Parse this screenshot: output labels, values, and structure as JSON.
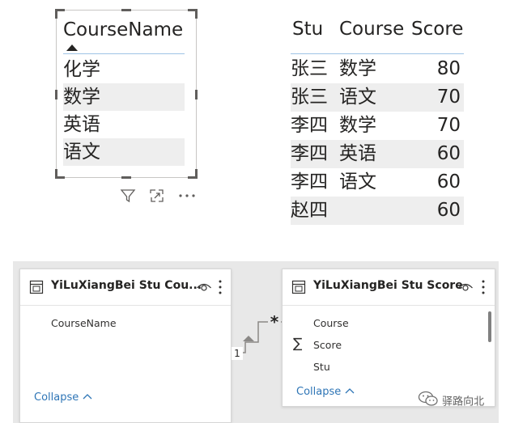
{
  "course_table": {
    "header": "CourseName",
    "rows": [
      "化学",
      "数学",
      "英语",
      "语文"
    ]
  },
  "visual_header_icons": [
    "filter-icon",
    "focus-mode-icon",
    "more-options-icon"
  ],
  "score_table": {
    "headers": [
      "Stu",
      "Course",
      "Score"
    ],
    "rows": [
      {
        "stu": "张三",
        "course": "数学",
        "score": "80"
      },
      {
        "stu": "张三",
        "course": "语文",
        "score": "70"
      },
      {
        "stu": "李四",
        "course": "数学",
        "score": "70"
      },
      {
        "stu": "李四",
        "course": "英语",
        "score": "60"
      },
      {
        "stu": "李四",
        "course": "语文",
        "score": "60"
      },
      {
        "stu": "赵四",
        "course": "",
        "score": "60"
      }
    ]
  },
  "model": {
    "course_card": {
      "title": "YiLuXiangBei Stu Cou...",
      "fields": [
        "CourseName"
      ],
      "collapse_label": "Collapse"
    },
    "score_card": {
      "title": "YiLuXiangBei Stu Score",
      "fields": [
        "Course",
        "Score",
        "Stu"
      ],
      "collapse_label": "Collapse"
    },
    "relationship": {
      "one_side": "1",
      "many_side": "*"
    }
  },
  "watermark": "驿路向北"
}
